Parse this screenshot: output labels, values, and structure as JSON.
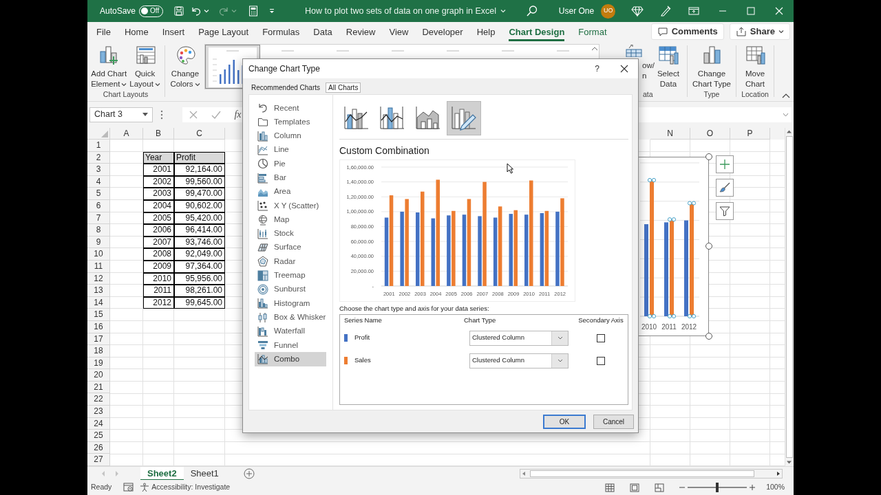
{
  "title_bar": {
    "autosave_label": "AutoSave",
    "autosave_state": "Off",
    "autosave_on": false,
    "title": "How to plot two sets of data on one graph in Excel",
    "user": "User One",
    "avatar": "UO"
  },
  "ribbon_tabs": [
    {
      "label": "File",
      "selected": false,
      "contextual": false
    },
    {
      "label": "Home",
      "selected": false,
      "contextual": false
    },
    {
      "label": "Insert",
      "selected": false,
      "contextual": false
    },
    {
      "label": "Page Layout",
      "selected": false,
      "contextual": false
    },
    {
      "label": "Formulas",
      "selected": false,
      "contextual": false
    },
    {
      "label": "Data",
      "selected": false,
      "contextual": false
    },
    {
      "label": "Review",
      "selected": false,
      "contextual": false
    },
    {
      "label": "View",
      "selected": false,
      "contextual": false
    },
    {
      "label": "Developer",
      "selected": false,
      "contextual": false
    },
    {
      "label": "Help",
      "selected": false,
      "contextual": false
    },
    {
      "label": "Chart Design",
      "selected": true,
      "contextual": true
    },
    {
      "label": "Format",
      "selected": false,
      "contextual": true
    }
  ],
  "ribbon_actions": [
    {
      "label": "Comments"
    },
    {
      "label": "Share"
    }
  ],
  "ribbon_left": [
    {
      "label": "Chart Layouts",
      "buttons": [
        {
          "label": "Add Chart\nElement",
          "dropdown": true
        },
        {
          "label": "Quick\nLayout",
          "dropdown": true
        }
      ]
    },
    {
      "buttons": [
        {
          "label": "Change\nColors",
          "dropdown": true
        }
      ]
    }
  ],
  "style_gallery": [
    {
      "selected": true
    },
    {
      "selected": false
    },
    {
      "selected": false
    },
    {
      "selected": false
    },
    {
      "selected": false
    },
    {
      "selected": false
    },
    {
      "selected": false
    }
  ],
  "ribbon_right": [
    {
      "label": "ata",
      "buttons": [
        {
          "label": "ow/\nn",
          "dropdown": false
        },
        {
          "label": "Select\nData",
          "dropdown": false
        }
      ]
    },
    {
      "label": "Type",
      "buttons": [
        {
          "label": "Change\nChart Type",
          "dropdown": false
        }
      ]
    },
    {
      "label": "Location",
      "buttons": [
        {
          "label": "Move\nChart",
          "dropdown": false
        }
      ]
    }
  ],
  "formula_bar": {
    "name_box": "Chart 3",
    "function_button": "fx"
  },
  "sheet": {
    "columns": [
      "A",
      "B",
      "C",
      "N",
      "O",
      "P"
    ],
    "row_numbers": [
      "1",
      "2",
      "3",
      "4",
      "5",
      "6",
      "7",
      "8",
      "9",
      "10",
      "11",
      "12",
      "13",
      "14",
      "15",
      "16",
      "17",
      "18",
      "19",
      "20",
      "21",
      "22",
      "23",
      "24",
      "25",
      "26",
      "27"
    ],
    "table": {
      "header": [
        "Year",
        "Profit"
      ],
      "rows": [
        [
          "2001",
          "92,164.00"
        ],
        [
          "2002",
          "99,560.00"
        ],
        [
          "2003",
          "99,470.00"
        ],
        [
          "2004",
          "90,602.00"
        ],
        [
          "2005",
          "95,420.00"
        ],
        [
          "2006",
          "96,414.00"
        ],
        [
          "2007",
          "93,746.00"
        ],
        [
          "2008",
          "92,049.00"
        ],
        [
          "2009",
          "97,364.00"
        ],
        [
          "2010",
          "95,956.00"
        ],
        [
          "2011",
          "98,261.00"
        ],
        [
          "2012",
          "99,645.00"
        ]
      ]
    }
  },
  "sheet_chart": {
    "selected": true,
    "labels": [
      "2010",
      "2011",
      "2012"
    ]
  },
  "sheet_tabs": [
    {
      "label": "Sheet2",
      "selected": true
    },
    {
      "label": "Sheet1",
      "selected": false
    }
  ],
  "status_bar": {
    "mode": "Ready",
    "accessibility": "Accessibility: Investigate",
    "zoom": "100%",
    "zoom_slider": {
      "level": 0.5
    }
  },
  "dialog": {
    "title": "Change Chart Type",
    "help": "?",
    "tabs": [
      {
        "label": "Recommended Charts",
        "selected": false
      },
      {
        "label": "All Charts",
        "selected": true
      }
    ],
    "chart_types": [
      {
        "label": "Recent",
        "selected": false
      },
      {
        "label": "Templates",
        "selected": false
      },
      {
        "label": "Column",
        "selected": false
      },
      {
        "label": "Line",
        "selected": false
      },
      {
        "label": "Pie",
        "selected": false
      },
      {
        "label": "Bar",
        "selected": false
      },
      {
        "label": "Area",
        "selected": false
      },
      {
        "label": "X Y (Scatter)",
        "selected": false
      },
      {
        "label": "Map",
        "selected": false
      },
      {
        "label": "Stock",
        "selected": false
      },
      {
        "label": "Surface",
        "selected": false
      },
      {
        "label": "Radar",
        "selected": false
      },
      {
        "label": "Treemap",
        "selected": false
      },
      {
        "label": "Sunburst",
        "selected": false
      },
      {
        "label": "Histogram",
        "selected": false
      },
      {
        "label": "Box & Whisker",
        "selected": false
      },
      {
        "label": "Waterfall",
        "selected": false
      },
      {
        "label": "Funnel",
        "selected": false
      },
      {
        "label": "Combo",
        "selected": true
      }
    ],
    "subtypes": [
      {
        "selected": false
      },
      {
        "selected": false
      },
      {
        "selected": false
      },
      {
        "selected": true
      }
    ],
    "combo_title": "Custom Combination",
    "chart_data": {
      "type": "bar",
      "categories": [
        "2001",
        "2002",
        "2003",
        "2004",
        "2005",
        "2006",
        "2007",
        "2008",
        "2009",
        "2010",
        "2011",
        "2012"
      ],
      "series": [
        {
          "color": "#4472c4",
          "values": [
            92000,
            100000,
            99000,
            91000,
            95000,
            96000,
            94000,
            92000,
            97000,
            96000,
            98000,
            100000
          ]
        },
        {
          "color": "#ed7d31",
          "values": [
            122000,
            117000,
            127000,
            143000,
            101000,
            117000,
            140000,
            107000,
            102000,
            142000,
            101000,
            118000
          ]
        }
      ],
      "ylim": [
        0,
        160000
      ],
      "grid": true,
      "yticks": [
        {
          "value": 0,
          "label": "-"
        },
        {
          "value": 20000,
          "label": "20,000.00"
        },
        {
          "value": 40000,
          "label": "40,000.00"
        },
        {
          "value": 60000,
          "label": "60,000.00"
        },
        {
          "value": 80000,
          "label": "80,000.00"
        },
        {
          "value": 100000,
          "label": "1,00,000.00"
        },
        {
          "value": 120000,
          "label": "1,20,000.00"
        },
        {
          "value": 140000,
          "label": "1,40,000.00"
        },
        {
          "value": 160000,
          "label": "1,60,000.00"
        }
      ]
    },
    "series_prompt": "Choose the chart type and axis for your data series:",
    "series_table": {
      "columns": [
        "Series Name",
        "Chart Type",
        "Secondary Axis"
      ],
      "rows": [
        {
          "name": "Profit",
          "color": "#4472c4",
          "chart_type": "Clustered Column",
          "secondary_axis": false
        },
        {
          "name": "Sales",
          "color": "#ed7d31",
          "chart_type": "Clustered Column",
          "secondary_axis": false
        }
      ]
    },
    "buttons": [
      {
        "label": "OK",
        "default": true
      },
      {
        "label": "Cancel",
        "default": false
      }
    ]
  }
}
